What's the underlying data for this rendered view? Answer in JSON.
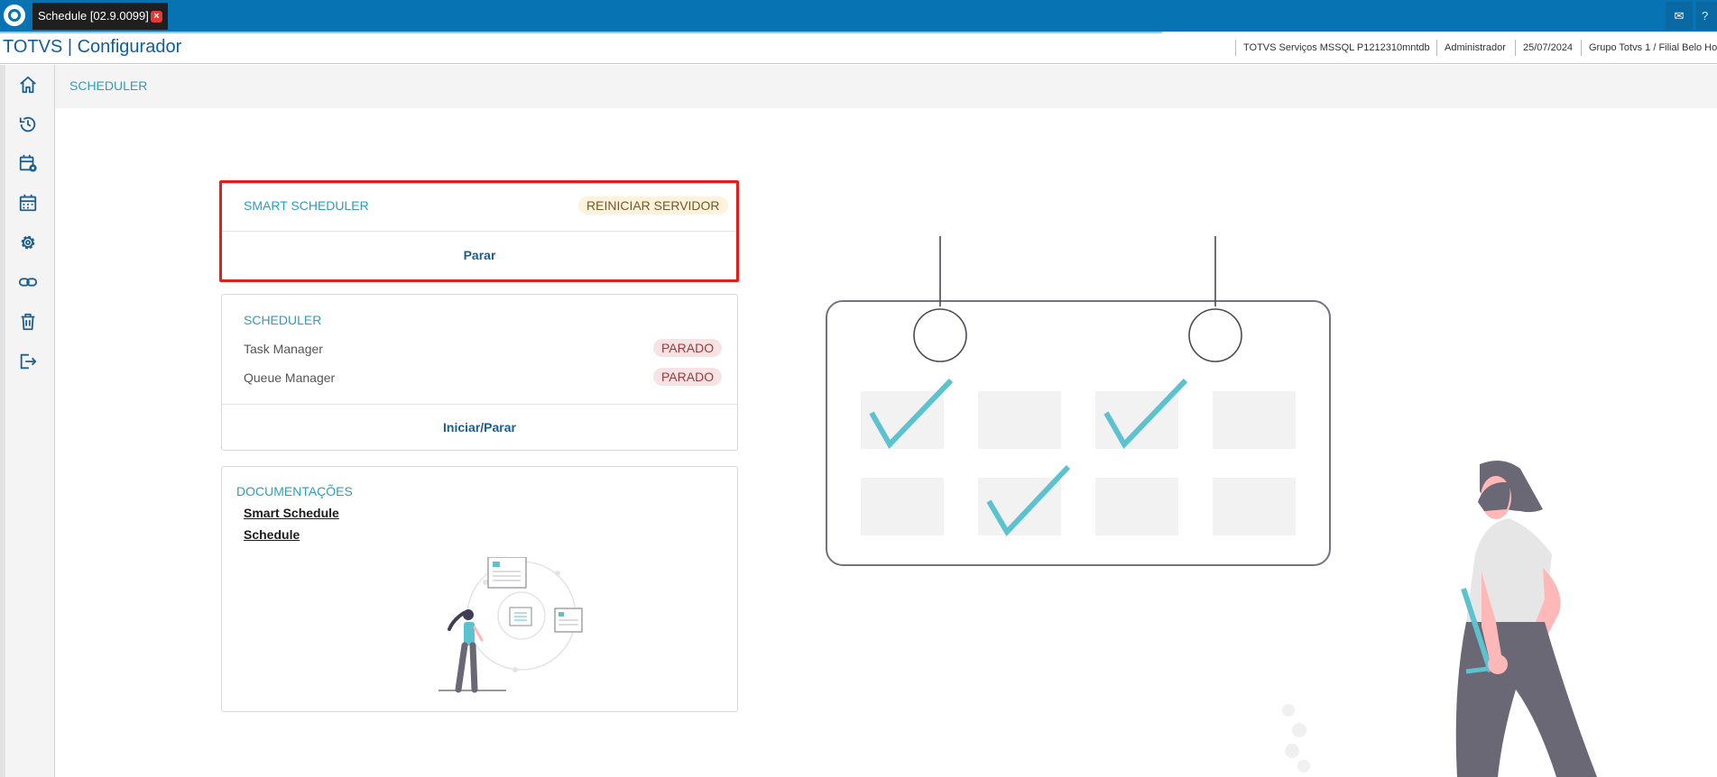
{
  "window": {
    "tab_title": "Schedule [02.9.0099]",
    "close_symbol": "×",
    "mail_symbol": "✉",
    "help_symbol": "?"
  },
  "header": {
    "app_title": "TOTVS | Configurador",
    "server": "TOTVS Serviços MSSQL P1212310mntdb",
    "user": "Administrador",
    "date": "25/07/2024",
    "company": "Grupo Totvs 1 / Filial Belo Ho"
  },
  "sidebar": {
    "items": [
      {
        "name": "home-icon"
      },
      {
        "name": "history-icon"
      },
      {
        "name": "calendar-settings-icon"
      },
      {
        "name": "calendar-icon"
      },
      {
        "name": "gear-icon"
      },
      {
        "name": "link-icon"
      },
      {
        "name": "trash-icon"
      },
      {
        "name": "logout-icon"
      }
    ]
  },
  "page": {
    "title": "SCHEDULER"
  },
  "smart_scheduler": {
    "title": "SMART SCHEDULER",
    "badge": "REINICIAR SERVIDOR",
    "action": "Parar"
  },
  "scheduler": {
    "title": "SCHEDULER",
    "rows": [
      {
        "label": "Task Manager",
        "status": "PARADO"
      },
      {
        "label": "Queue Manager",
        "status": "PARADO"
      }
    ],
    "action": "Iniciar/Parar"
  },
  "docs": {
    "title": "DOCUMENTAÇÕES",
    "links": [
      "Smart Schedule",
      "Schedule"
    ]
  },
  "colors": {
    "brand": "#0873b3",
    "accent": "#2e9dbd",
    "check": "#5cc2cf",
    "highlight": "#e51c1c"
  }
}
